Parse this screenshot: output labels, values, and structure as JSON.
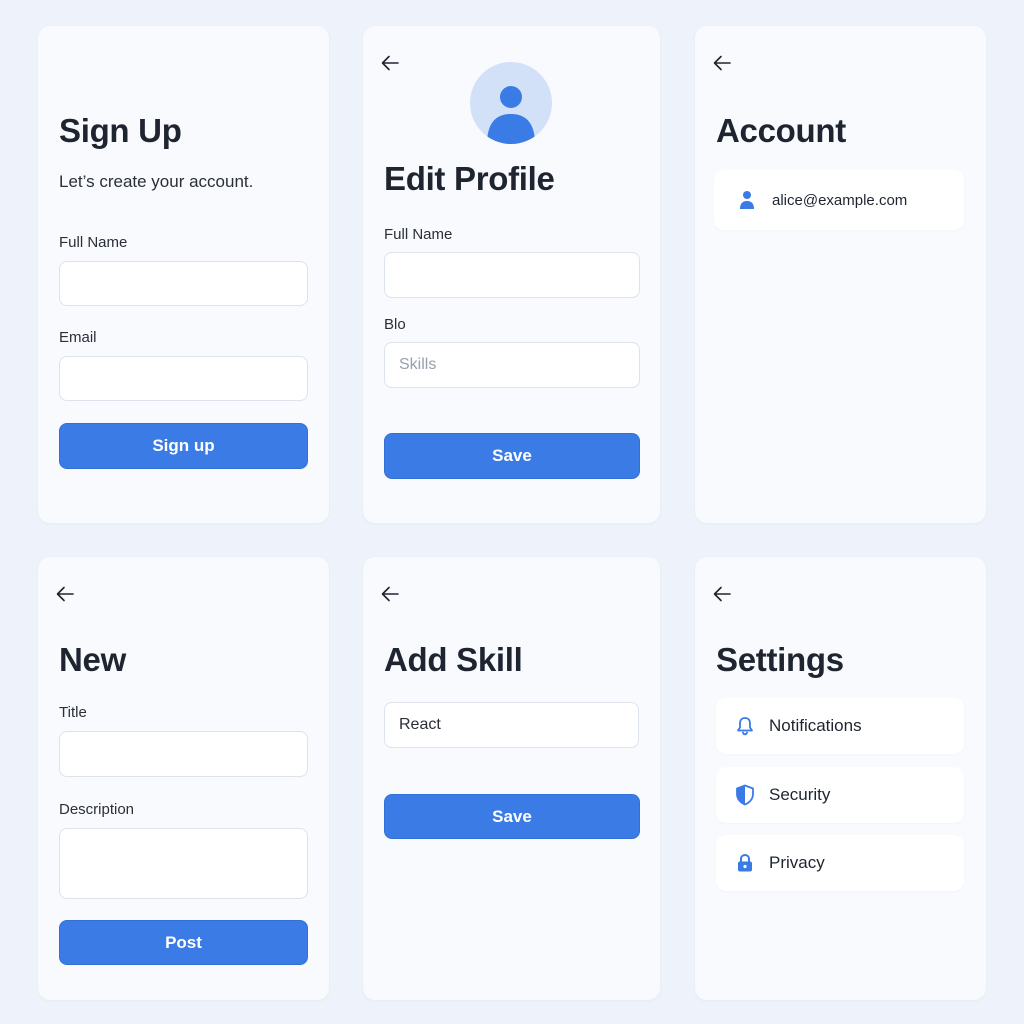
{
  "colors": {
    "accent": "#3b7be5",
    "background": "#eef3fb",
    "card": "#f8fafd"
  },
  "signup": {
    "title": "Sign Up",
    "subtitle": "Let’s create your account.",
    "full_name_label": "Full Name",
    "full_name_value": "",
    "email_label": "Email",
    "email_value": "",
    "button": "Sign up"
  },
  "edit_profile": {
    "back_icon": "arrow-left-icon",
    "avatar_icon": "user-icon",
    "title": "Edit Profile",
    "full_name_label": "Full Name",
    "full_name_value": "",
    "bio_label": "Blo",
    "bio_placeholder": "Skills",
    "button": "Save"
  },
  "account": {
    "back_icon": "arrow-left-icon",
    "title": "Account",
    "email_icon": "user-icon",
    "email": "alice@example.com"
  },
  "new_post": {
    "back_icon": "arrow-left-icon",
    "title": "New",
    "title_label": "Title",
    "title_value": "",
    "description_label": "Description",
    "description_value": "",
    "button": "Post"
  },
  "add_skill": {
    "back_icon": "arrow-left-icon",
    "title": "Add Skill",
    "skill_value": "React",
    "button": "Save"
  },
  "settings": {
    "back_icon": "arrow-left-icon",
    "title": "Settings",
    "items": [
      {
        "label": "Notifications",
        "icon": "bell-icon"
      },
      {
        "label": "Security",
        "icon": "shield-icon"
      },
      {
        "label": "Privacy",
        "icon": "lock-icon"
      }
    ]
  }
}
